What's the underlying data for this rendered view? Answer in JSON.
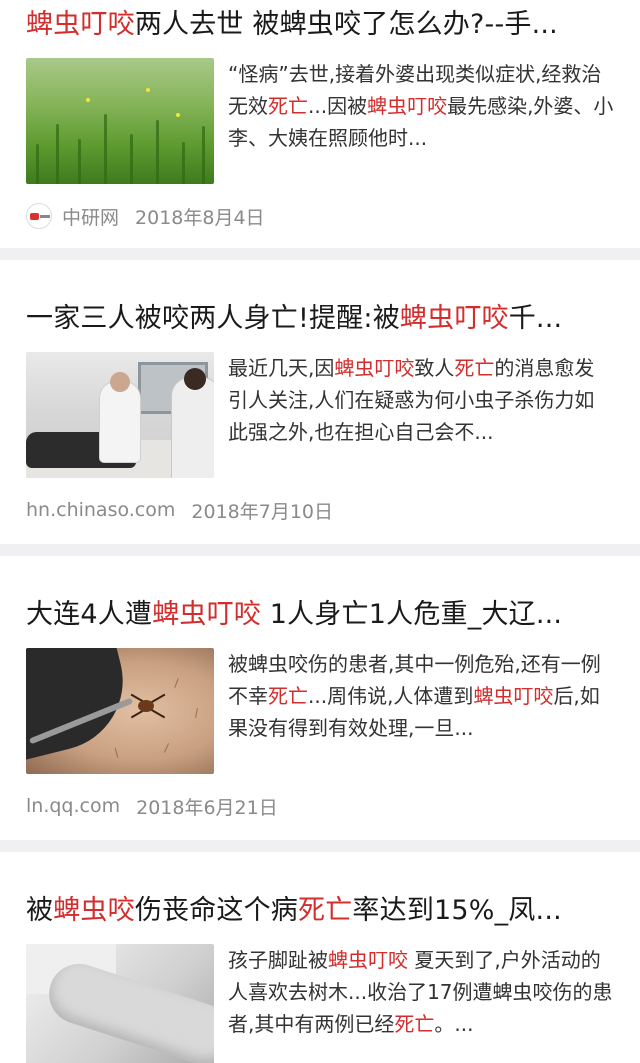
{
  "articles": [
    {
      "title_parts": [
        {
          "text": "蜱虫叮咬",
          "hl": true
        },
        {
          "text": "两人去世 被蜱虫咬了怎么办?--手...",
          "hl": false
        }
      ],
      "snippet_parts": [
        {
          "text": "“怪病”去世,接着外婆出现类似症状,经救治无效",
          "hl": false
        },
        {
          "text": "死亡",
          "hl": true
        },
        {
          "text": "...因被",
          "hl": false
        },
        {
          "text": "蜱虫叮咬",
          "hl": true
        },
        {
          "text": "最先感染,外婆、小李、大姨在照顾他时...",
          "hl": false
        }
      ],
      "thumbnail_icon": "grass-photo",
      "source": "中研网",
      "source_icon": "zhongyan-logo-icon",
      "date": "2018年8月4日"
    },
    {
      "title_parts": [
        {
          "text": "一家三人被咬两人身亡!提醒:被",
          "hl": false
        },
        {
          "text": "蜱虫叮咬",
          "hl": true
        },
        {
          "text": "千...",
          "hl": false
        }
      ],
      "snippet_parts": [
        {
          "text": "最近几天,因",
          "hl": false
        },
        {
          "text": "蜱虫叮咬",
          "hl": true
        },
        {
          "text": "致人",
          "hl": false
        },
        {
          "text": "死亡",
          "hl": true
        },
        {
          "text": "的消息愈发引人关注,人们在疑惑为何小虫子杀伤力如此强之外,也在担心自己会不...",
          "hl": false
        }
      ],
      "thumbnail_icon": "hospital-ward-photo",
      "source": "hn.chinaso.com",
      "date": "2018年7月10日"
    },
    {
      "title_parts": [
        {
          "text": "大连4人遭",
          "hl": false
        },
        {
          "text": "蜱虫叮咬",
          "hl": true
        },
        {
          "text": " 1人身亡1人危重_大辽...",
          "hl": false
        }
      ],
      "snippet_parts": [
        {
          "text": "被蜱虫咬伤的患者,其中一例危殆,还有一例不幸",
          "hl": false
        },
        {
          "text": "死亡",
          "hl": true
        },
        {
          "text": "...周伟说,人体遭到",
          "hl": false
        },
        {
          "text": "蜱虫叮咬",
          "hl": true
        },
        {
          "text": "后,如果没有得到有效处理,一旦...",
          "hl": false
        }
      ],
      "thumbnail_icon": "tick-on-skin-photo",
      "source": "ln.qq.com",
      "date": "2018年6月21日"
    },
    {
      "title_parts": [
        {
          "text": "被",
          "hl": false
        },
        {
          "text": "蜱虫咬",
          "hl": true
        },
        {
          "text": "伤丧命这个病",
          "hl": false
        },
        {
          "text": "死亡",
          "hl": true
        },
        {
          "text": "率达到15%_凤...",
          "hl": false
        }
      ],
      "snippet_parts": [
        {
          "text": "孩子脚趾被",
          "hl": false
        },
        {
          "text": "蜱虫叮咬",
          "hl": true
        },
        {
          "text": " 夏天到了,户外活动的人喜欢去树木...收治了17例遭蜱虫咬伤的患者,其中有两例已经",
          "hl": false
        },
        {
          "text": "死亡",
          "hl": true
        },
        {
          "text": "。...",
          "hl": false
        }
      ],
      "thumbnail_icon": "arm-bw-photo"
    }
  ],
  "colors": {
    "highlight": "#d32e2e",
    "background_gap": "#f0f0f2",
    "meta_text": "#8a8a8a"
  }
}
